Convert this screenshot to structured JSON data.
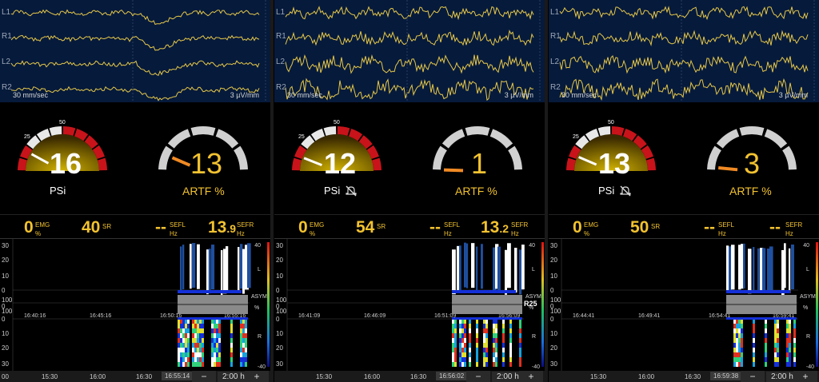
{
  "colors": {
    "accent": "#f2c230",
    "artifact": "#f08a24",
    "gauge_red": "#c8131a",
    "gauge_gray": "#d0d0d0",
    "eeg_bg": "#061a3b",
    "trace": "#e6c84a"
  },
  "panels": [
    {
      "channels": [
        "L1",
        "R1",
        "L2",
        "R2"
      ],
      "eeg_speed": "30 mm/sec",
      "eeg_scale": "3 µV/mm",
      "psi": {
        "value": "16",
        "label": "PSi",
        "muted": false,
        "needle": 16,
        "tick_labels": [
          "25",
          "50"
        ]
      },
      "artf": {
        "value": "13",
        "label": "ARTF %",
        "needle": 13
      },
      "params": {
        "emg": "0",
        "emg_label": "EMG",
        "emg_unit": "%",
        "sr": "40",
        "sr_label": "SR",
        "sefl": "--",
        "sefl_label": "SEFL",
        "sefl_unit": "Hz",
        "sefr_int": "13",
        "sefr_dec": ".9",
        "sefr_label": "SEFR",
        "sefr_unit": "Hz"
      },
      "dsa": {
        "left_axis": [
          "30",
          "20",
          "10",
          "0",
          "100",
          "0",
          "100",
          "0",
          "10",
          "20",
          "30"
        ],
        "right_labels": [
          "L",
          "ASYM",
          "%",
          "R"
        ],
        "right_extra": "",
        "color_scale": [
          "40",
          "-40"
        ],
        "times": [
          "16:40:16",
          "16:45:16",
          "16:50:16",
          "16:55:16"
        ]
      },
      "timeline": {
        "left_stub": "00",
        "ticks": [
          "15:30",
          "16:00",
          "16:30"
        ],
        "current": "16:55:14",
        "minus": "−",
        "duration": "2:00 h",
        "plus": "+"
      }
    },
    {
      "channels": [
        "L1",
        "R1",
        "L2",
        "R2"
      ],
      "eeg_speed": "30 mm/sec",
      "eeg_scale": "3 µV/mm",
      "psi": {
        "value": "12",
        "label": "PSi",
        "muted": true,
        "needle": 12,
        "tick_labels": [
          "25",
          "50"
        ]
      },
      "artf": {
        "value": "1",
        "label": "ARTF %",
        "needle": 1
      },
      "params": {
        "emg": "0",
        "emg_label": "EMG",
        "emg_unit": "%",
        "sr": "54",
        "sr_label": "SR",
        "sefl": "--",
        "sefl_label": "SEFL",
        "sefl_unit": "Hz",
        "sefr_int": "13",
        "sefr_dec": ".2",
        "sefr_label": "SEFR",
        "sefr_unit": "Hz"
      },
      "dsa": {
        "left_axis": [
          "30",
          "20",
          "10",
          "0",
          "100",
          "0",
          "100",
          "0",
          "10",
          "20",
          "30"
        ],
        "right_labels": [
          "L",
          "ASYM",
          "%",
          "R"
        ],
        "right_extra": "R25",
        "color_scale": [
          "40",
          "-40"
        ],
        "times": [
          "16:41:09",
          "16:46:09",
          "16:51:09",
          "16:56:09"
        ]
      },
      "timeline": {
        "left_stub": "",
        "ticks": [
          "15:30",
          "16:00",
          "16:30"
        ],
        "current": "16:56:02",
        "minus": "−",
        "duration": "2:00 h",
        "plus": "+"
      }
    },
    {
      "channels": [
        "L1",
        "R1",
        "L2",
        "R2"
      ],
      "eeg_speed": "30 mm/sec",
      "eeg_scale": "3 µV/mm",
      "psi": {
        "value": "13",
        "label": "PSi",
        "muted": true,
        "needle": 13,
        "tick_labels": [
          "25",
          "50"
        ]
      },
      "artf": {
        "value": "3",
        "label": "ARTF %",
        "needle": 3
      },
      "params": {
        "emg": "0",
        "emg_label": "EMG",
        "emg_unit": "%",
        "sr": "50",
        "sr_label": "SR",
        "sefl": "--",
        "sefl_label": "SEFL",
        "sefl_unit": "Hz",
        "sefr_int": "--",
        "sefr_dec": "",
        "sefr_label": "SEFR",
        "sefr_unit": "Hz"
      },
      "dsa": {
        "left_axis": [
          "30",
          "20",
          "10",
          "0",
          "100",
          "0",
          "100",
          "0",
          "10",
          "20",
          "30"
        ],
        "right_labels": [
          "L",
          "ASYM",
          "%",
          "R"
        ],
        "right_extra": "",
        "color_scale": [
          "40",
          "-40"
        ],
        "times": [
          "16:44:41",
          "16:49:41",
          "16:54:41",
          "16:59:41"
        ]
      },
      "timeline": {
        "left_stub": "",
        "ticks": [
          "15:30",
          "16:00",
          "16:30"
        ],
        "current": "16:59:38",
        "minus": "−",
        "duration": "2:00 h",
        "plus": "+"
      }
    }
  ]
}
